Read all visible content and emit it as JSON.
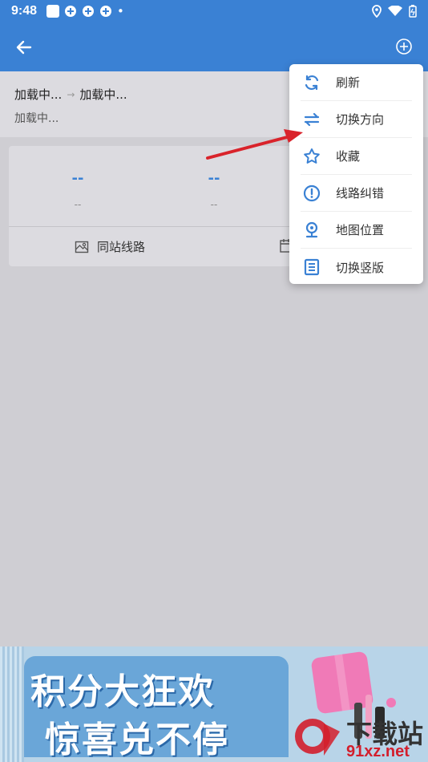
{
  "status_bar": {
    "time": "9:48"
  },
  "route": {
    "from": "加载中...",
    "to": "加载中...",
    "subtitle": "加载中..."
  },
  "card": {
    "stats": [
      {
        "value": "--",
        "label": "--"
      },
      {
        "value": "--",
        "label": "--"
      }
    ],
    "action_same_station": "同站线路"
  },
  "menu": {
    "items": [
      {
        "label": "刷新",
        "icon": "refresh-icon"
      },
      {
        "label": "切换方向",
        "icon": "swap-icon"
      },
      {
        "label": "收藏",
        "icon": "star-icon"
      },
      {
        "label": "线路纠错",
        "icon": "alert-icon"
      },
      {
        "label": "地图位置",
        "icon": "map-pin-icon"
      },
      {
        "label": "切换竖版",
        "icon": "list-icon"
      }
    ]
  },
  "banner": {
    "line1": "积分大狂欢",
    "line2": "惊喜兑不停",
    "watermark_cn": "下载站",
    "watermark_url": "91xz.net"
  },
  "colors": {
    "accent": "#3a81d4",
    "overlay": "#cfced3",
    "annotation_arrow": "#d9232b"
  }
}
